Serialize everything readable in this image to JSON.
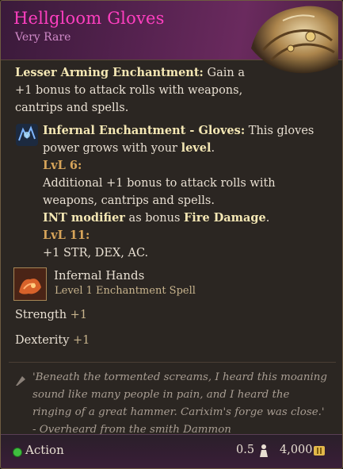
{
  "item": {
    "title": "Hellgloom Gloves",
    "rarity": "Very Rare"
  },
  "lesser_arming": {
    "label": "Lesser Arming Enchantment:",
    "text": " Gain a +1 bonus to attack rolls with weapons, cantrips and spells."
  },
  "infernal": {
    "label": "Infernal Enchantment - Gloves:",
    "text": " This gloves power grows with your ",
    "level_word": "level",
    "level_end": ".",
    "lvl6_label": "LvL 6:",
    "lvl6_text": "Additional +1 bonus to attack rolls with weapons, cantrips and spells.",
    "int_label": "INT modifier",
    "int_mid": " as bonus ",
    "fire_label": "Fire Damage",
    "fire_end": ".",
    "lvl11_label": "LvL 11:",
    "lvl11_text": "+1 STR, DEX, AC."
  },
  "spell": {
    "name": "Infernal Hands",
    "subtitle": "Level 1 Enchantment Spell",
    "icon": "infernal-hands-icon"
  },
  "stats": [
    {
      "name": "Strength",
      "value": "+1"
    },
    {
      "name": "Dexterity",
      "value": "+1"
    }
  ],
  "flavor": {
    "quote": "'Beneath the tormented screams, I heard this moaning sound like many people in pain, and I heard the ringing of a great hammer. Carixim's forge was close.' - Overheard from the smith Dammon"
  },
  "footer": {
    "action_label": "Action",
    "weight": "0.5",
    "price": "4,000"
  },
  "colors": {
    "title": "#ff3fc0",
    "rarity": "#d08ac8",
    "highlight": "#f4e7b4",
    "level_label": "#d8a55a",
    "action_dot": "#3fbf3f"
  }
}
